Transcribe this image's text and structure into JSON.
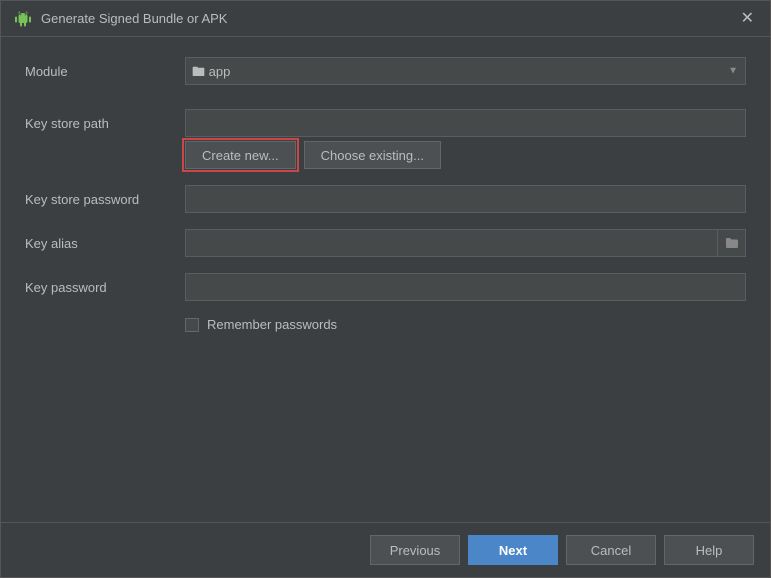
{
  "dialog": {
    "title": "Generate Signed Bundle or APK",
    "close_label": "✕"
  },
  "module_row": {
    "label": "Module",
    "value": "app",
    "icon": "module-icon",
    "arrow": "▼"
  },
  "keystore_path": {
    "label": "Key store path",
    "value": "",
    "placeholder": ""
  },
  "buttons": {
    "create_new": "Create new...",
    "choose_existing": "Choose existing..."
  },
  "keystore_password": {
    "label": "Key store password",
    "value": "",
    "placeholder": ""
  },
  "key_alias": {
    "label": "Key alias",
    "value": "",
    "placeholder": ""
  },
  "key_password": {
    "label": "Key password",
    "value": "",
    "placeholder": ""
  },
  "remember": {
    "label": "Remember passwords",
    "checked": false
  },
  "footer": {
    "previous": "Previous",
    "next": "Next",
    "cancel": "Cancel",
    "help": "Help"
  }
}
